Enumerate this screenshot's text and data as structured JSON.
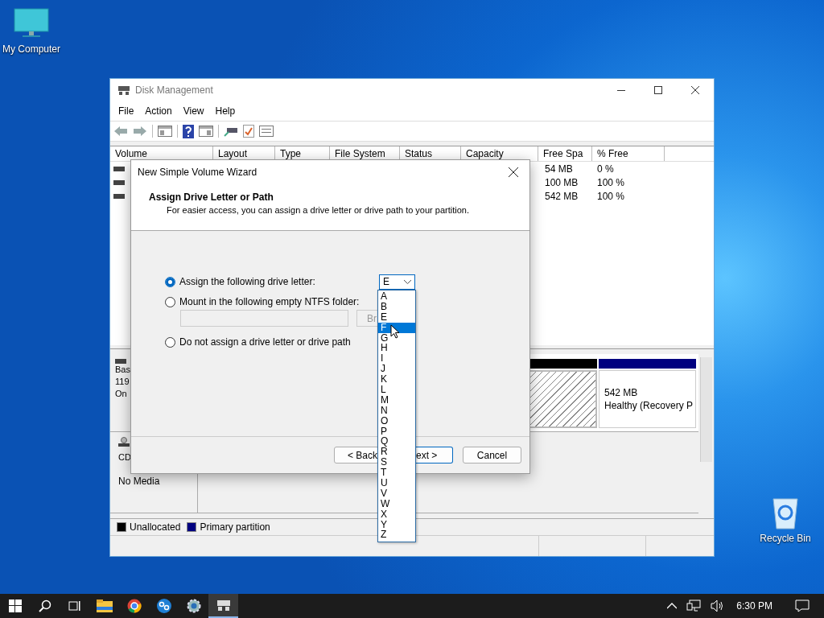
{
  "desktop_icons": [
    {
      "kind": "computer",
      "label": "My Computer"
    },
    {
      "kind": "recycle",
      "label": "Recycle Bin"
    }
  ],
  "window": {
    "title": "Disk Management",
    "menu": [
      "File",
      "Action",
      "View",
      "Help"
    ],
    "columns": [
      "Volume",
      "Layout",
      "Type",
      "File System",
      "Status",
      "Capacity",
      "Free Spa",
      "% Free"
    ],
    "rows": [
      {
        "free_space": "54 MB",
        "percent_free": "0 %"
      },
      {
        "free_space": "100 MB",
        "percent_free": "100 %"
      },
      {
        "free_space": "542 MB",
        "percent_free": "100 %"
      }
    ],
    "disks": [
      {
        "kind": "disk",
        "label_lines": [
          "Bas",
          "119",
          "On"
        ],
        "partitions": [
          {
            "kind": "unallocated",
            "color": "#000000",
            "selected": true
          },
          {
            "kind": "primary",
            "color": "#000080",
            "selected": false,
            "size": "542 MB",
            "status": "Healthy (Recovery P"
          }
        ]
      },
      {
        "kind": "cdrom",
        "label_lines": [
          "CD"
        ],
        "media": "No Media"
      }
    ],
    "legend": [
      {
        "label": "Unallocated",
        "color": "#000000"
      },
      {
        "label": "Primary partition",
        "color": "#000080"
      }
    ]
  },
  "wizard": {
    "title": "New Simple Volume Wizard",
    "heading": "Assign Drive Letter or Path",
    "subheading": "For easier access, you can assign a drive letter or drive path to your partition.",
    "options": [
      {
        "label": "Assign the following drive letter:",
        "selected": true
      },
      {
        "label": "Mount in the following empty NTFS folder:",
        "selected": false
      },
      {
        "label": "Do not assign a drive letter or drive path",
        "selected": false
      }
    ],
    "drive_letter": "E",
    "browse": "Br",
    "buttons": [
      "< Back",
      "ext >",
      "Cancel"
    ],
    "letters": [
      {
        "label": "A",
        "selected": false
      },
      {
        "label": "B",
        "selected": false
      },
      {
        "label": "E",
        "selected": false
      },
      {
        "label": "F",
        "selected": true
      },
      {
        "label": "G",
        "selected": false
      },
      {
        "label": "H",
        "selected": false
      },
      {
        "label": "I",
        "selected": false
      },
      {
        "label": "J",
        "selected": false
      },
      {
        "label": "K",
        "selected": false
      },
      {
        "label": "L",
        "selected": false
      },
      {
        "label": "M",
        "selected": false
      },
      {
        "label": "N",
        "selected": false
      },
      {
        "label": "O",
        "selected": false
      },
      {
        "label": "P",
        "selected": false
      },
      {
        "label": "Q",
        "selected": false
      },
      {
        "label": "R",
        "selected": false
      },
      {
        "label": "S",
        "selected": false
      },
      {
        "label": "T",
        "selected": false
      },
      {
        "label": "U",
        "selected": false
      },
      {
        "label": "V",
        "selected": false
      },
      {
        "label": "W",
        "selected": false
      },
      {
        "label": "X",
        "selected": false
      },
      {
        "label": "Y",
        "selected": false
      },
      {
        "label": "Z",
        "selected": false
      }
    ]
  },
  "taskbar": {
    "apps": [
      {
        "kind": "explorer",
        "active": false
      },
      {
        "kind": "chrome",
        "active": false
      },
      {
        "kind": "blueapp",
        "active": false
      },
      {
        "kind": "settings",
        "active": false
      },
      {
        "kind": "diskmgmt",
        "active": true
      }
    ],
    "clock": "6:30 PM"
  }
}
